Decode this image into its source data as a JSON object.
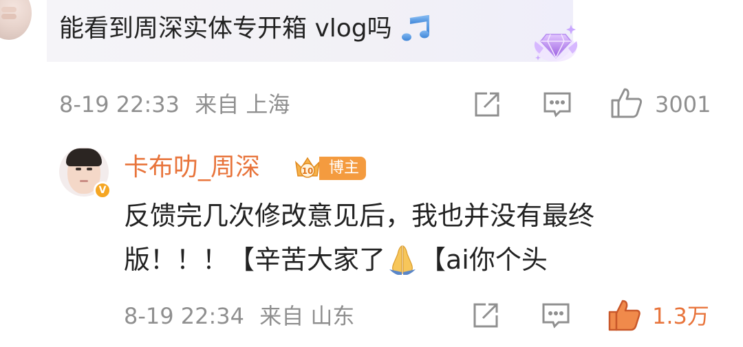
{
  "colors": {
    "accent_orange": "#e8743b",
    "meta_gray": "#8f8f8f",
    "badge_orange": "#f49b3f",
    "gem_purple": "#b07ae8"
  },
  "top_comment": {
    "text": "能看到周深实体专开箱 vlog吗",
    "emoji": "musical-notes-icon",
    "badge": "gem-badge-icon",
    "time": "8-19 22:33",
    "location": "来自 上海",
    "likes": "3001"
  },
  "reply": {
    "author": "卡布叻_周深",
    "level_badge": "10",
    "role_badge": "博主",
    "line1": "反馈完几次修改意见后，我也并没有最终",
    "line2_a": "版！！！【辛苦大家了",
    "line2_b": "【ai你个头",
    "time": "8-19 22:34",
    "location": "来自 山东",
    "likes": "1.3万"
  }
}
